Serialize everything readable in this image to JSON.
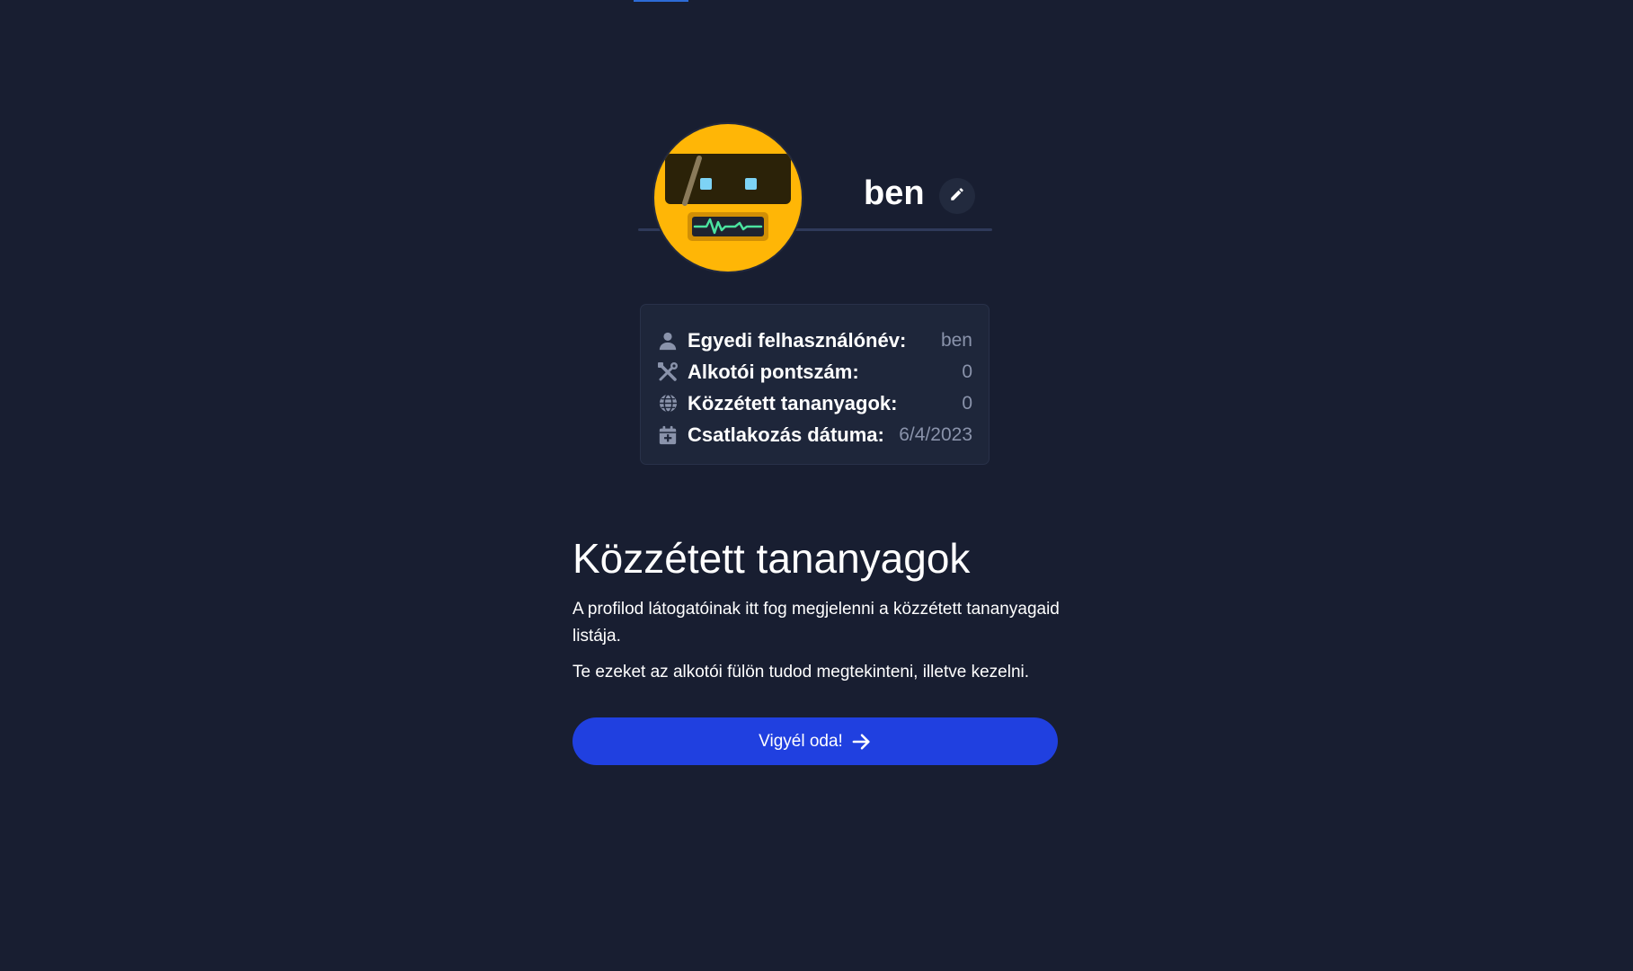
{
  "profile": {
    "username": "ben",
    "avatar_icon": "robot-avatar-icon",
    "edit_icon": "pencil-icon"
  },
  "stats": [
    {
      "icon": "user-icon",
      "label": "Egyedi felhasználónév:",
      "value": "ben"
    },
    {
      "icon": "tools-icon",
      "label": "Alkotói pontszám:",
      "value": "0"
    },
    {
      "icon": "globe-icon",
      "label": "Közzétett tananyagok:",
      "value": "0"
    },
    {
      "icon": "calendar-plus-icon",
      "label": "Csatlakozás dátuma:",
      "value": "6/4/2023"
    }
  ],
  "published": {
    "title": "Közzétett tananyagok",
    "text1": "A profilod látogatóinak itt fog megjelenni a közzétett tananyagaid listája.",
    "text2": "Te ezeket az alkotói fülön tudod megtekinteni, illetve kezelni.",
    "button_label": "Vigyél oda!",
    "button_icon": "arrow-right-icon"
  },
  "colors": {
    "background": "#181e31",
    "card": "#1e263a",
    "accent_button": "#2040e0",
    "avatar_yellow": "#ffb606",
    "muted_text": "#8a93ab"
  }
}
